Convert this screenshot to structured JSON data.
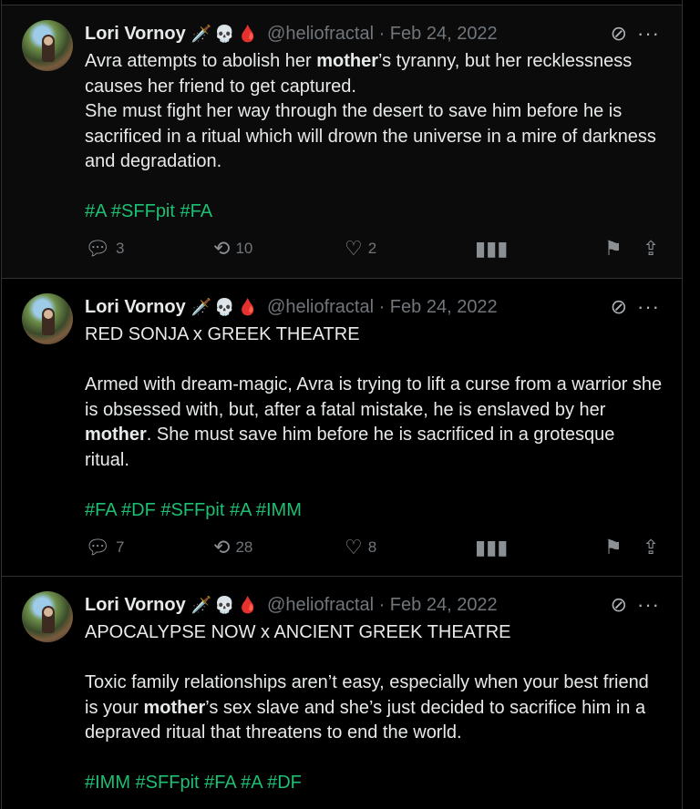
{
  "posts": [
    {
      "author": "Lori Vornoy",
      "emojis": [
        "🗡️",
        "💀",
        "🩸"
      ],
      "handle": "@heliofractal · Feb 24, 2022",
      "lines": [
        {
          "pre": "Avra attempts to abolish her ",
          "bold": "mother",
          "post": "’s tyranny, but her recklessness causes her friend to get captured."
        },
        {
          "pre": "She must fight her way through the desert to save him before he is sacrificed in a ritual which will drown the universe in a mire of darkness and degradation.",
          "bold": "",
          "post": ""
        }
      ],
      "hashtags": "#A #SFFpit #FA",
      "replies": "3",
      "reposts": "10",
      "likes": "2"
    },
    {
      "author": "Lori Vornoy",
      "emojis": [
        "🗡️",
        "💀",
        "🩸"
      ],
      "handle": "@heliofractal · Feb 24, 2022",
      "lines": [
        {
          "pre": "RED SONJA x GREEK THEATRE",
          "bold": "",
          "post": ""
        },
        {
          "pre": "Armed with dream-magic, Avra is trying to lift a curse from a warrior she is obsessed with, but, after a fatal mistake, he is enslaved by her ",
          "bold": "mother",
          "post": ". She must save him before he is sacrificed in a grotesque ritual."
        }
      ],
      "hashtags": "#FA #DF #SFFpit #A #IMM",
      "replies": "7",
      "reposts": "28",
      "likes": "8"
    },
    {
      "author": "Lori Vornoy",
      "emojis": [
        "🗡️",
        "💀",
        "🩸"
      ],
      "handle": "@heliofractal · Feb 24, 2022",
      "lines": [
        {
          "pre": "APOCALYPSE NOW x ANCIENT GREEK THEATRE",
          "bold": "",
          "post": ""
        },
        {
          "pre": "Toxic family relationships aren’t easy, especially when your best friend is your ",
          "bold": "mother",
          "post": "’s sex slave and she’s just decided to sacrifice him in a depraved ritual that threatens to end the world."
        }
      ],
      "hashtags": "#IMM #SFFpit #FA #A #DF"
    }
  ],
  "icons": {
    "reply": "reply-icon",
    "repost": "repost-icon",
    "like": "heart-icon",
    "views": "views-icon",
    "bookmark": "bookmark-icon",
    "share": "share-icon",
    "grok": "grok-icon",
    "more": "more-icon"
  },
  "colors": {
    "hashtag": "#1dbf73",
    "muted": "#71767b",
    "background": "#000000"
  }
}
